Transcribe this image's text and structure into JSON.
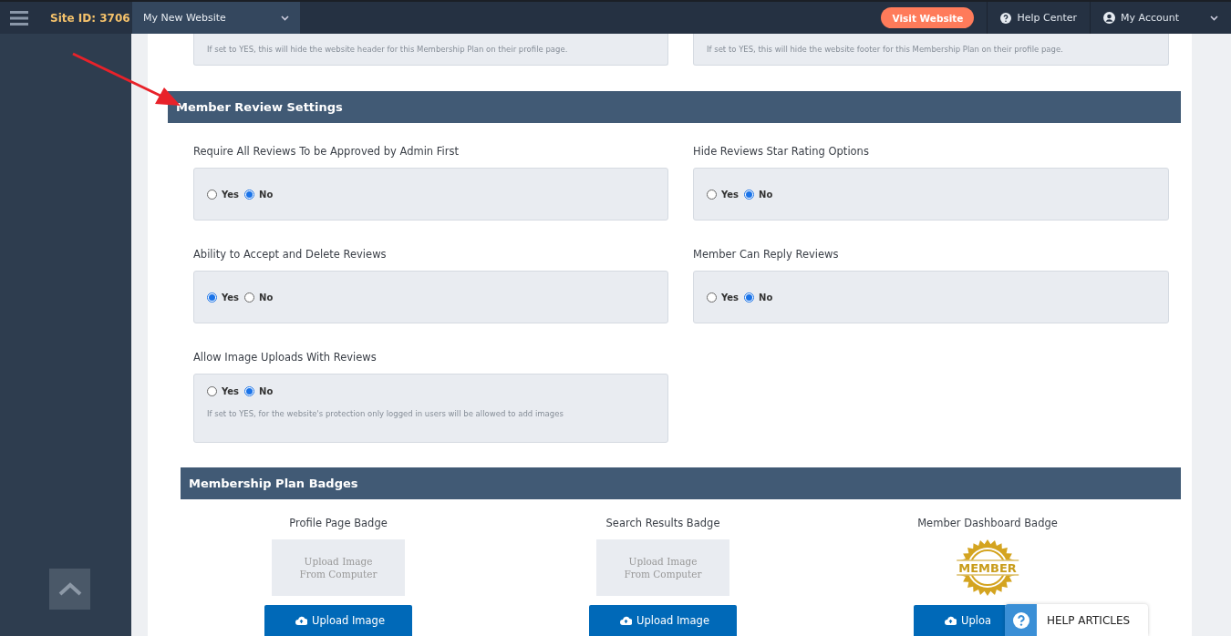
{
  "topbar": {
    "site_id": "Site ID: 3706",
    "website_select": "My New Website",
    "visit_button": "Visit Website",
    "help_center": "Help Center",
    "account": "My Account"
  },
  "top_notes": [
    "If set to YES, this will hide the website header for this Membership Plan on their profile page.",
    "If set to YES, this will hide the website footer for this Membership Plan on their profile page."
  ],
  "review_section": {
    "title": "Member Review Settings",
    "settings": [
      {
        "label": "Require All Reviews To be Approved by Admin First",
        "options": [
          {
            "label": "Yes",
            "selected": false
          },
          {
            "label": "No",
            "selected": true
          }
        ]
      },
      {
        "label": "Hide Reviews Star Rating Options",
        "options": [
          {
            "label": "Yes",
            "selected": false
          },
          {
            "label": "No",
            "selected": true
          }
        ]
      },
      {
        "label": "Ability to Accept and Delete Reviews",
        "options": [
          {
            "label": "Yes",
            "selected": true
          },
          {
            "label": "No",
            "selected": false
          }
        ]
      },
      {
        "label": "Member Can Reply Reviews",
        "options": [
          {
            "label": "Yes",
            "selected": false
          },
          {
            "label": "No",
            "selected": true
          }
        ]
      },
      {
        "label": "Allow Image Uploads With Reviews",
        "options": [
          {
            "label": "Yes",
            "selected": false
          },
          {
            "label": "No",
            "selected": true
          }
        ],
        "note": "If set to YES, for the website's protection only logged in users will be allowed to add images"
      }
    ]
  },
  "badge_section": {
    "title": "Membership Plan Badges",
    "badges": [
      {
        "title": "Profile Page Badge",
        "preview": {
          "kind": "placeholder",
          "lines": [
            "Upload Image",
            "From Computer"
          ]
        },
        "button": "Upload Image"
      },
      {
        "title": "Search Results Badge",
        "preview": {
          "kind": "placeholder",
          "lines": [
            "Upload Image",
            "From Computer"
          ]
        },
        "button": "Upload Image"
      },
      {
        "title": "Member Dashboard Badge",
        "preview": {
          "kind": "seal",
          "text": "MEMBER"
        },
        "button": "Uploa"
      }
    ]
  },
  "help_widget": {
    "label": "HELP ARTICLES"
  }
}
